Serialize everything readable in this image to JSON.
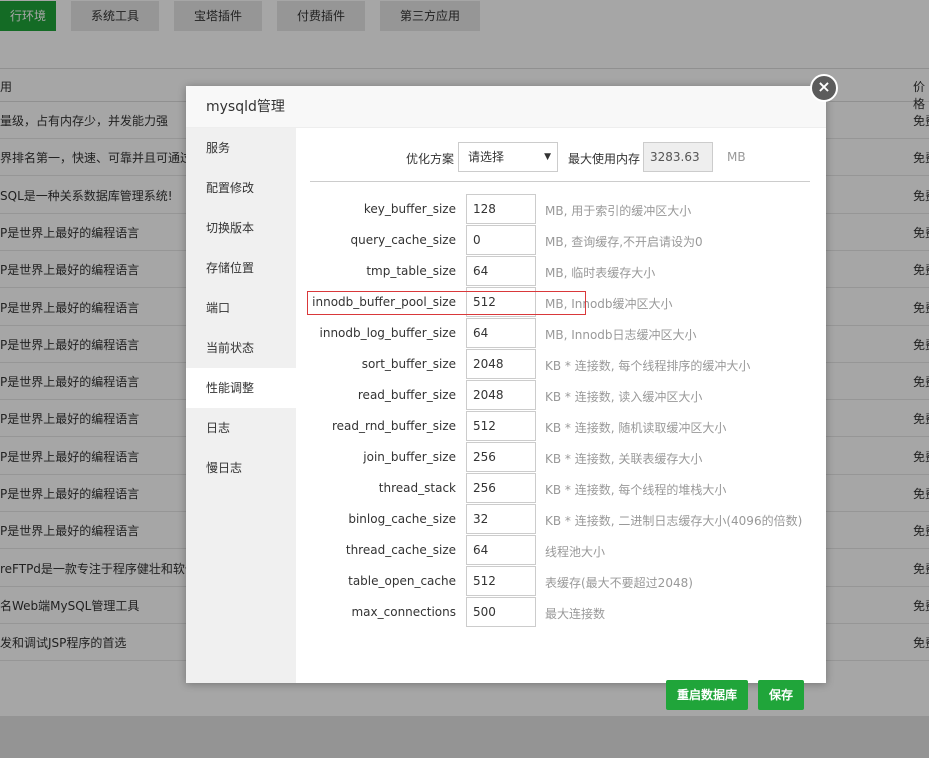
{
  "background": {
    "tabs": [
      {
        "label": "行环境",
        "active": true
      },
      {
        "label": "系统工具",
        "active": false
      },
      {
        "label": "宝塔插件",
        "active": false
      },
      {
        "label": "付费插件",
        "active": false
      },
      {
        "label": "第三方应用",
        "active": false
      }
    ],
    "table_head": {
      "col_desc": "用",
      "col_price": "价格"
    },
    "rows": [
      {
        "desc": "量级，占有内存少，并发能力强",
        "price": "免费"
      },
      {
        "desc": "界排名第一，快速、可靠并且可通过",
        "price": "免费"
      },
      {
        "desc": "SQL是一种关系数据库管理系统!",
        "price": "免费"
      },
      {
        "desc": "P是世界上最好的编程语言",
        "price": "免费"
      },
      {
        "desc": "P是世界上最好的编程语言",
        "price": "免费"
      },
      {
        "desc": "P是世界上最好的编程语言",
        "price": "免费"
      },
      {
        "desc": "P是世界上最好的编程语言",
        "price": "免费"
      },
      {
        "desc": "P是世界上最好的编程语言",
        "price": "免费"
      },
      {
        "desc": "P是世界上最好的编程语言",
        "price": "免费"
      },
      {
        "desc": "P是世界上最好的编程语言",
        "price": "免费"
      },
      {
        "desc": "P是世界上最好的编程语言",
        "price": "免费"
      },
      {
        "desc": "P是世界上最好的编程语言",
        "price": "免费"
      },
      {
        "desc": "reFTPd是一款专注于程序健壮和软件",
        "price": "免费"
      },
      {
        "desc": "名Web端MySQL管理工具",
        "price": "免费"
      },
      {
        "desc": "发和调试JSP程序的首选",
        "price": "免费"
      }
    ]
  },
  "modal": {
    "title": "mysqld管理",
    "close_icon": "×",
    "sidebar": [
      {
        "label": "服务",
        "active": false
      },
      {
        "label": "配置修改",
        "active": false
      },
      {
        "label": "切换版本",
        "active": false
      },
      {
        "label": "存储位置",
        "active": false
      },
      {
        "label": "端口",
        "active": false
      },
      {
        "label": "当前状态",
        "active": false
      },
      {
        "label": "性能调整",
        "active": true
      },
      {
        "label": "日志",
        "active": false
      },
      {
        "label": "慢日志",
        "active": false
      }
    ],
    "optimize": {
      "label": "优化方案",
      "select_value": "请选择",
      "caret": "▼",
      "max_mem_label": "最大使用内存",
      "max_mem_value": "3283.63",
      "max_mem_unit": "MB"
    },
    "params": [
      {
        "name": "key_buffer_size",
        "value": "128",
        "note": "MB, 用于索引的缓冲区大小"
      },
      {
        "name": "query_cache_size",
        "value": "0",
        "note": "MB, 查询缓存,不开启请设为0"
      },
      {
        "name": "tmp_table_size",
        "value": "64",
        "note": "MB, 临时表缓存大小"
      },
      {
        "name": "innodb_buffer_pool_size",
        "value": "512",
        "note": "MB, Innodb缓冲区大小"
      },
      {
        "name": "innodb_log_buffer_size",
        "value": "64",
        "note": "MB, Innodb日志缓冲区大小"
      },
      {
        "name": "sort_buffer_size",
        "value": "2048",
        "note": "KB * 连接数, 每个线程排序的缓冲大小"
      },
      {
        "name": "read_buffer_size",
        "value": "2048",
        "note": "KB * 连接数, 读入缓冲区大小"
      },
      {
        "name": "read_rnd_buffer_size",
        "value": "512",
        "note": "KB * 连接数, 随机读取缓冲区大小"
      },
      {
        "name": "join_buffer_size",
        "value": "256",
        "note": "KB * 连接数, 关联表缓存大小"
      },
      {
        "name": "thread_stack",
        "value": "256",
        "note": "KB * 连接数, 每个线程的堆栈大小"
      },
      {
        "name": "binlog_cache_size",
        "value": "32",
        "note": "KB * 连接数, 二进制日志缓存大小(4096的倍数)"
      },
      {
        "name": "thread_cache_size",
        "value": "64",
        "note": "线程池大小"
      },
      {
        "name": "table_open_cache",
        "value": "512",
        "note": "表缓存(最大不要超过2048)"
      },
      {
        "name": "max_connections",
        "value": "500",
        "note": "最大连接数"
      }
    ],
    "buttons": {
      "restart": "重启数据库",
      "save": "保存"
    }
  }
}
